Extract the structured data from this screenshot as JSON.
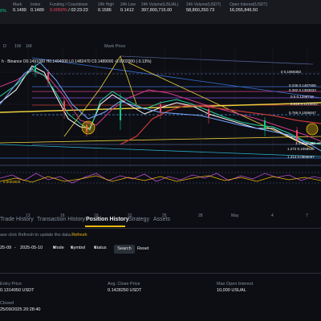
{
  "header": {
    "change": "6%",
    "stats": [
      {
        "label": "Mark",
        "value": "0.1489",
        "color": "normal"
      },
      {
        "label": "Index",
        "value": "0.1489",
        "color": "normal"
      },
      {
        "label": "Funding / Countdown",
        "value": "0.0050%",
        "value2": "02:23:23",
        "color": "orange"
      },
      {
        "label": "24h High",
        "value": "0.1586",
        "color": "normal"
      },
      {
        "label": "24h Low",
        "value": "0.1412",
        "color": "normal"
      },
      {
        "label": "24h Volume(USUAL)",
        "value": "397,800,715.00",
        "color": "normal"
      },
      {
        "label": "24h Volume(USDT)",
        "value": "58,860,250.73",
        "color": "normal"
      },
      {
        "label": "Open Interest(USDT)",
        "value": "16,055,846.50",
        "color": "normal"
      }
    ]
  },
  "toolbar": {
    "intervals": [
      "D",
      "1W",
      "1M"
    ],
    "price_type": "Mark Price"
  },
  "chart": {
    "legend": "h · Binance  O0.1491000  H0.1494000  L0.1482470  C0.1489000  -0.0002000 (-0.13%)",
    "x_ticks": [
      "13",
      "16",
      "19",
      "22",
      "25",
      "28",
      "May",
      "4",
      "7"
    ],
    "fib_labels": [
      "0 0.1959383",
      "0.236 0.1487908",
      "0.382 0.1383833",
      "0.5 0.1299718",
      "0.618 0.1215602",
      "0.786 0.1095847",
      "1 0.0943362",
      "1.272 0.1058545",
      "1.414 0.0855057",
      "0.0002600"
    ]
  },
  "tabs": [
    "Trade History",
    "Transaction History",
    "Position History",
    "Strategy",
    "Assets"
  ],
  "active_tab": "Position History",
  "hint": {
    "text": "ase click Refresh to update the data.",
    "link": "Refresh"
  },
  "filters": {
    "date_from": "25-09",
    "sep": "-",
    "date_to": "2025-05-10",
    "mode": "Mode",
    "symbol": "Symbol",
    "status": "Status",
    "search": "Search",
    "reset": "Reset"
  },
  "position": {
    "entry_label": "Entry Price",
    "entry_value": "0.1314050 USDT",
    "avg_close_label": "Avg. Close Price",
    "avg_close_value": "0.1428250 USDT",
    "max_oi_label": "Max Open Interest",
    "max_oi_value": "10,000 USUAL",
    "closed_label": "Closed",
    "closed_value": "25/09/2025 20:28:40"
  }
}
